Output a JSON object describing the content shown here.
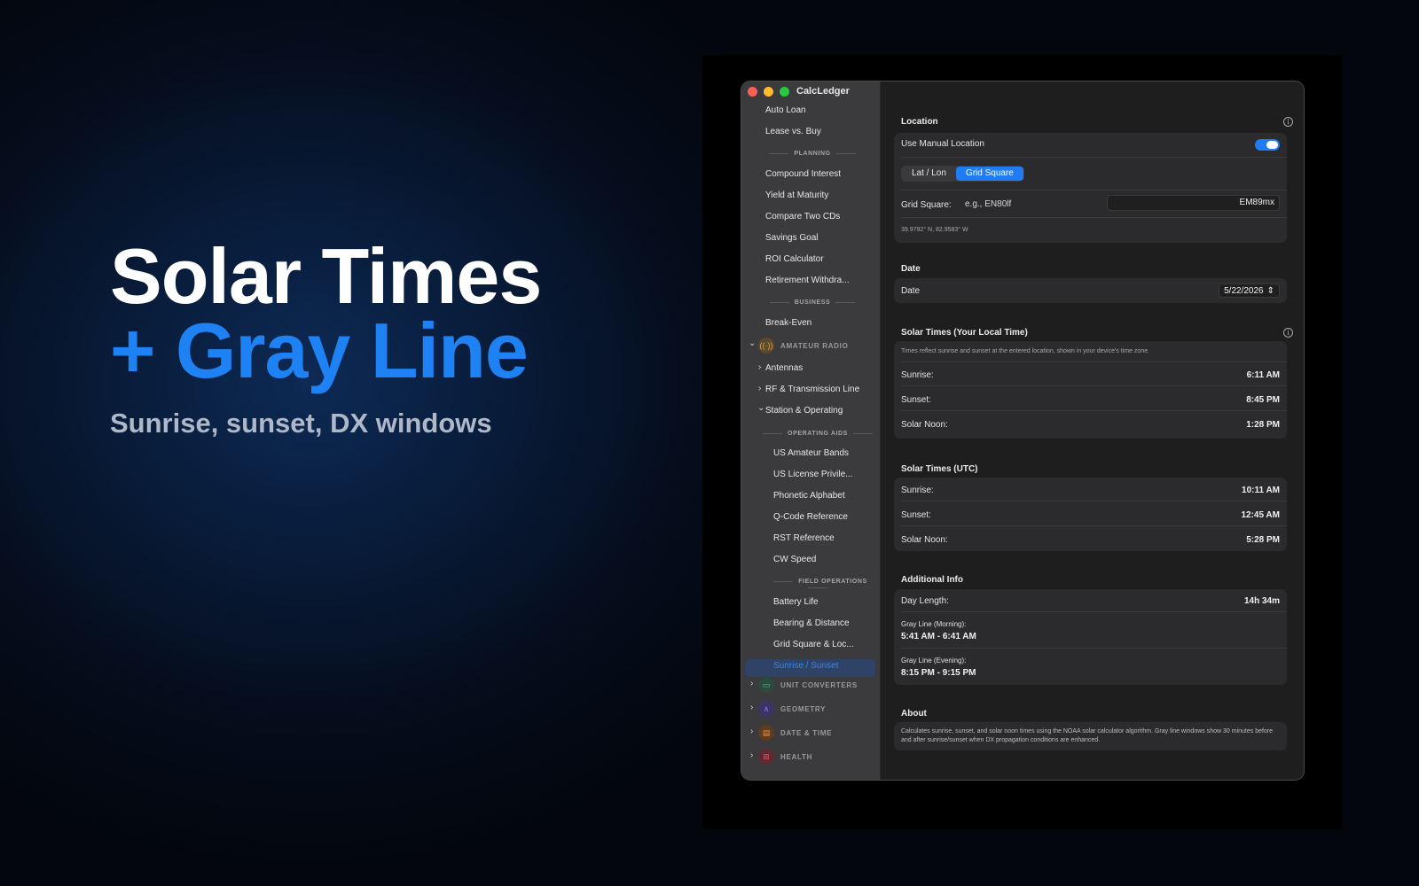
{
  "hero": {
    "line1": "Solar Times",
    "line2": "+ Gray Line",
    "subtitle": "Sunrise, sunset, DX windows"
  },
  "window": {
    "title": "CalcLedger"
  },
  "sidebar": {
    "top_items": [
      "Auto Loan",
      "Lease vs. Buy"
    ],
    "planning_header": "PLANNING",
    "planning_items": [
      "Compound Interest",
      "Yield at Maturity",
      "Compare Two CDs",
      "Savings Goal",
      "ROI Calculator",
      "Retirement Withdra..."
    ],
    "business_header": "BUSINESS",
    "business_items": [
      "Break-Even"
    ],
    "amateur_radio": "AMATEUR RADIO",
    "radio_groups": [
      "Antennas",
      "RF & Transmission Line",
      "Station & Operating"
    ],
    "operating_aids_header": "OPERATING AIDS",
    "operating_aids": [
      "US Amateur Bands",
      "US License Privile...",
      "Phonetic Alphabet",
      "Q-Code Reference",
      "RST Reference",
      "CW Speed"
    ],
    "field_ops_header": "FIELD OPERATIONS",
    "field_ops": [
      "Battery Life",
      "Bearing & Distance",
      "Grid Square & Loc...",
      "Sunrise / Sunset"
    ],
    "categories": [
      "UNIT CONVERTERS",
      "GEOMETRY",
      "DATE & TIME",
      "HEALTH"
    ]
  },
  "location": {
    "title": "Location",
    "manual_label": "Use Manual Location",
    "seg_latlon": "Lat / Lon",
    "seg_grid": "Grid Square",
    "grid_label": "Grid Square:",
    "grid_placeholder": "e.g., EN80lf",
    "grid_value": "EM89mx",
    "coords": "39.9792° N, 82.9583° W"
  },
  "date": {
    "title": "Date",
    "label": "Date",
    "value": "5/22/2026"
  },
  "local": {
    "title": "Solar Times (Your Local Time)",
    "note": "Times reflect sunrise and sunset at the entered location, shown in your device's time zone.",
    "sunrise_label": "Sunrise:",
    "sunrise": "6:11 AM",
    "sunset_label": "Sunset:",
    "sunset": "8:45 PM",
    "noon_label": "Solar Noon:",
    "noon": "1:28 PM"
  },
  "utc": {
    "title": "Solar Times (UTC)",
    "sunrise_label": "Sunrise:",
    "sunrise": "10:11 AM",
    "sunset_label": "Sunset:",
    "sunset": "12:45 AM",
    "noon_label": "Solar Noon:",
    "noon": "5:28 PM"
  },
  "additional": {
    "title": "Additional Info",
    "day_length_label": "Day Length:",
    "day_length": "14h 34m",
    "gl_morning_label": "Gray Line (Morning):",
    "gl_morning": "5:41 AM - 6:41 AM",
    "gl_evening_label": "Gray Line (Evening):",
    "gl_evening": "8:15 PM - 9:15 PM"
  },
  "about": {
    "title": "About",
    "text": "Calculates sunrise, sunset, and solar noon times using the NOAA solar calculator algorithm. Gray line windows show 30 minutes before and after sunrise/sunset when DX propagation conditions are enhanced."
  },
  "colors": {
    "accent": "#1f7cf2",
    "hero_blue": "#1e82f5",
    "selection": "#2f4366"
  }
}
